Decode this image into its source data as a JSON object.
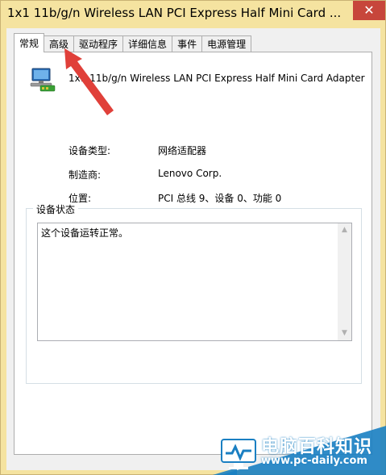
{
  "window": {
    "title": "1x1 11b/g/n Wireless LAN PCI Express Half Mini Card ...",
    "close_glyph": "✕"
  },
  "tabs": [
    {
      "label": "常规",
      "active": true
    },
    {
      "label": "高级",
      "active": false
    },
    {
      "label": "驱动程序",
      "active": false
    },
    {
      "label": "详细信息",
      "active": false
    },
    {
      "label": "事件",
      "active": false
    },
    {
      "label": "电源管理",
      "active": false
    }
  ],
  "device": {
    "icon": "network-adapter-icon",
    "name": "1x1 11b/g/n Wireless LAN PCI Express Half Mini Card Adapter"
  },
  "properties": [
    {
      "label": "设备类型:",
      "value": "网络适配器"
    },
    {
      "label": "制造商:",
      "value": "Lenovo Corp."
    },
    {
      "label": "位置:",
      "value": "PCI 总线 9、设备 0、功能 0"
    }
  ],
  "status_group": {
    "title": "设备状态",
    "text": "这个设备运转正常。"
  },
  "watermark": {
    "text": "电脑百科知识",
    "url": "www.pc-daily.com"
  },
  "colors": {
    "title_bar": "#f5e3a0",
    "close_button": "#c7463b",
    "annotation_arrow": "#e0403a"
  }
}
